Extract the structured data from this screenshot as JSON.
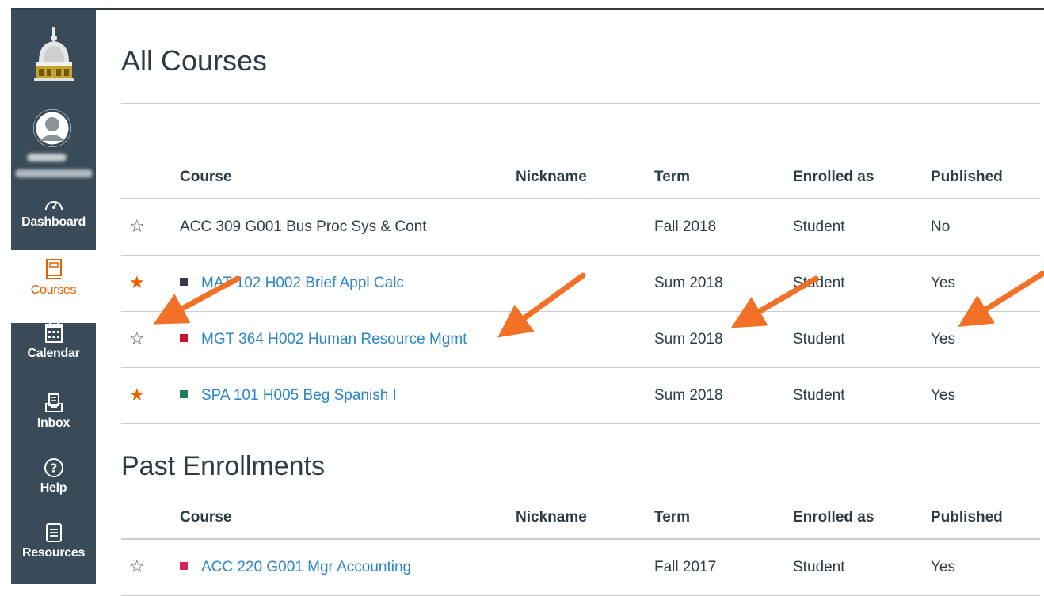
{
  "nav": {
    "items": [
      {
        "label": "Dashboard",
        "icon": "speedometer-icon",
        "active": false
      },
      {
        "label": "Courses",
        "icon": "book-icon",
        "active": true
      },
      {
        "label": "Calendar",
        "icon": "calendar-icon",
        "active": false
      },
      {
        "label": "Inbox",
        "icon": "inbox-icon",
        "active": false
      },
      {
        "label": "Help",
        "icon": "help-icon",
        "active": false
      },
      {
        "label": "Resources",
        "icon": "document-icon",
        "active": false
      }
    ]
  },
  "page": {
    "title": "All Courses",
    "columns": {
      "course": "Course",
      "nickname": "Nickname",
      "term": "Term",
      "enrolled": "Enrolled as",
      "published": "Published"
    }
  },
  "current": {
    "rows": [
      {
        "favorite": false,
        "color": "",
        "course": "ACC 309 G001 Bus Proc Sys & Cont",
        "linked": false,
        "nickname": "",
        "term": "Fall 2018",
        "enrolled": "Student",
        "published": "No"
      },
      {
        "favorite": true,
        "color": "#3a3a4a",
        "course": "MAT 102 H002 Brief Appl Calc",
        "linked": true,
        "nickname": "",
        "term": "Sum 2018",
        "enrolled": "Student",
        "published": "Yes"
      },
      {
        "favorite": false,
        "color": "#c8102e",
        "course": "MGT 364 H002 Human Resource Mgmt",
        "linked": true,
        "nickname": "",
        "term": "Sum 2018",
        "enrolled": "Student",
        "published": "Yes"
      },
      {
        "favorite": true,
        "color": "#1f7a5c",
        "course": "SPA 101 H005 Beg Spanish I",
        "linked": true,
        "nickname": "",
        "term": "Sum 2018",
        "enrolled": "Student",
        "published": "Yes"
      }
    ]
  },
  "past": {
    "title": "Past Enrollments",
    "rows": [
      {
        "favorite": false,
        "color": "#d6215a",
        "course": "ACC 220 G001 Mgr Accounting",
        "linked": true,
        "nickname": "",
        "term": "Fall 2017",
        "enrolled": "Student",
        "published": "Yes"
      }
    ]
  },
  "colors": {
    "nav_bg": "#394b58",
    "accent": "#e66000",
    "link": "#2a86c9",
    "annotation_arrow": "#f26a1b"
  }
}
